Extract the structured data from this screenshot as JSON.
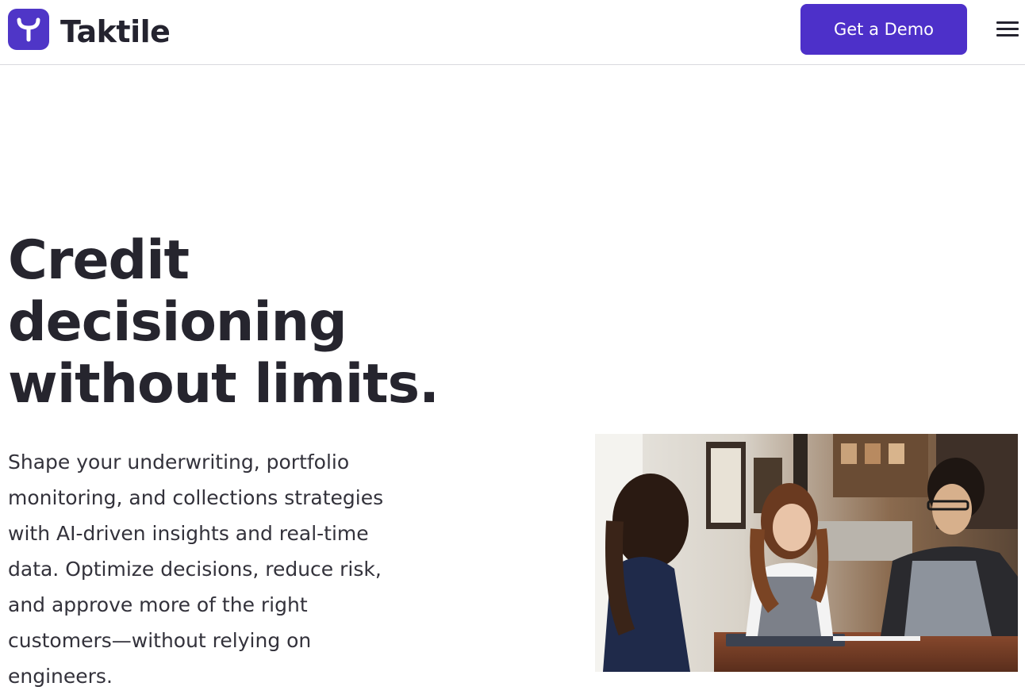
{
  "header": {
    "brand_name": "Taktile",
    "logo_icon": "taktile-logo-icon",
    "cta_label": "Get a Demo",
    "menu_icon": "hamburger-menu-icon"
  },
  "hero": {
    "title_lines": [
      "Credit",
      "decisioning",
      "without limits."
    ],
    "body_lines": [
      "Shape your underwriting, portfolio",
      "monitoring, and collections strategies",
      "with AI-driven insights and real-time",
      "data. Optimize decisions, reduce risk,",
      "and approve more of the right",
      "customers—without relying on",
      "engineers."
    ]
  },
  "colors": {
    "brand_purple": "#4f36c7",
    "button_purple": "#4d30c9",
    "text_dark": "#24232f"
  }
}
